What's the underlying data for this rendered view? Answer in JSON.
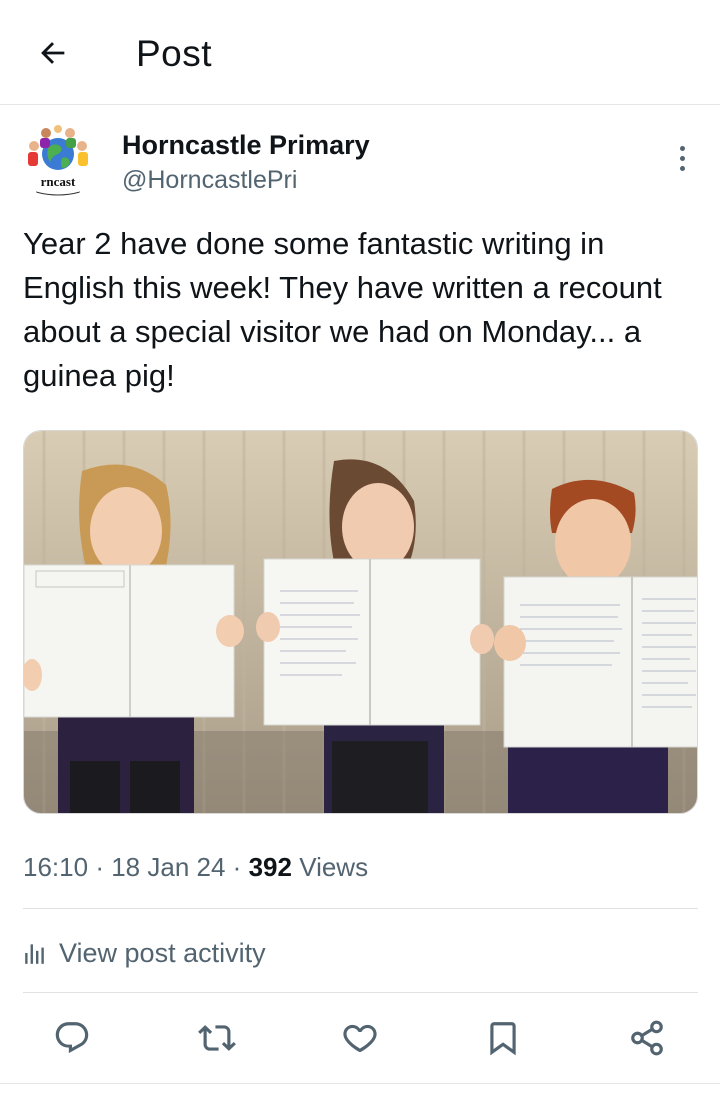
{
  "header": {
    "title": "Post",
    "back_icon": "arrow-left-icon"
  },
  "author": {
    "name": "Horncastle Primary",
    "handle": "@HorncastlePri",
    "avatar_text": "rncast"
  },
  "post": {
    "text": "Year 2 have done some fantastic writing in English this week! They have written a recount about a special visitor we had on Monday... a guinea pig!",
    "media_icon": "photo-of-three-children-holding-exercise-books"
  },
  "meta": {
    "time": "16:10",
    "separator": "·",
    "date": "18 Jan 24",
    "views_count": "392",
    "views_label": "Views"
  },
  "activity": {
    "label": "View post activity",
    "icon": "bar-chart-icon"
  },
  "actions": [
    {
      "name": "reply",
      "icon": "reply-icon"
    },
    {
      "name": "repost",
      "icon": "repost-icon"
    },
    {
      "name": "like",
      "icon": "heart-icon"
    },
    {
      "name": "bookmark",
      "icon": "bookmark-icon"
    },
    {
      "name": "share",
      "icon": "share-icon"
    }
  ],
  "colors": {
    "text_primary": "#0f1419",
    "text_secondary": "#536471",
    "divider": "#e1e1e1",
    "background": "#ffffff"
  }
}
